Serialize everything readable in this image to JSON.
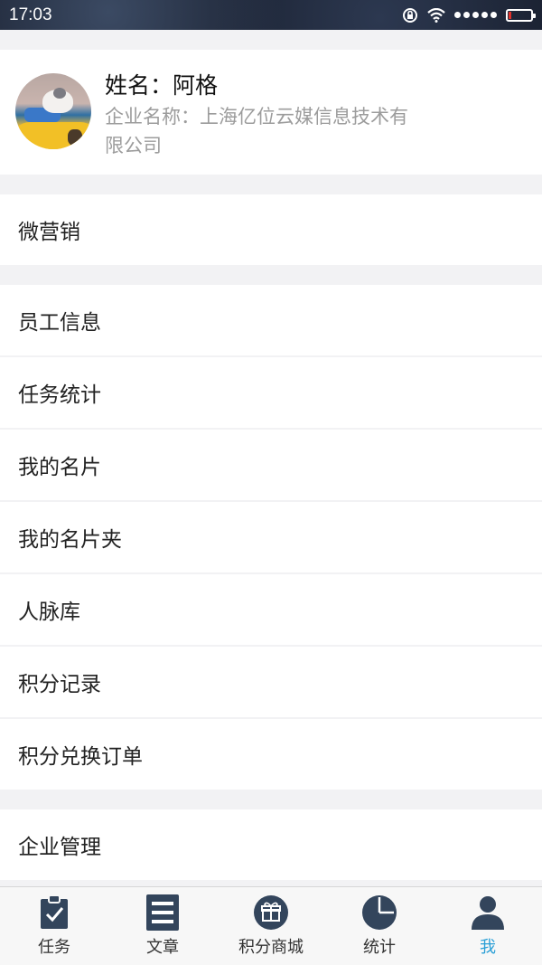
{
  "status_bar": {
    "time": "17:03",
    "battery_level": 0.1
  },
  "profile": {
    "name_line": "姓名：阿格",
    "company_line": "企业名称：上海亿位云媒信息技术有限公司"
  },
  "menu": {
    "weiyingxiao": "微营销",
    "employee_info": "员工信息",
    "task_stats": "任务统计",
    "my_card": "我的名片",
    "my_card_folder": "我的名片夹",
    "contacts_library": "人脉库",
    "points_record": "积分记录",
    "points_exchange_orders": "积分兑换订单",
    "enterprise_management": "企业管理"
  },
  "tabs": [
    {
      "label": "任务",
      "icon": "clipboard-check-icon"
    },
    {
      "label": "文章",
      "icon": "article-list-icon"
    },
    {
      "label": "积分商城",
      "icon": "gift-icon"
    },
    {
      "label": "统计",
      "icon": "pie-chart-icon"
    },
    {
      "label": "我",
      "icon": "person-icon",
      "active": true
    }
  ],
  "colors": {
    "accent": "#2a9fd6",
    "icon_dark": "#33455c",
    "battery_low": "#e1322c"
  }
}
